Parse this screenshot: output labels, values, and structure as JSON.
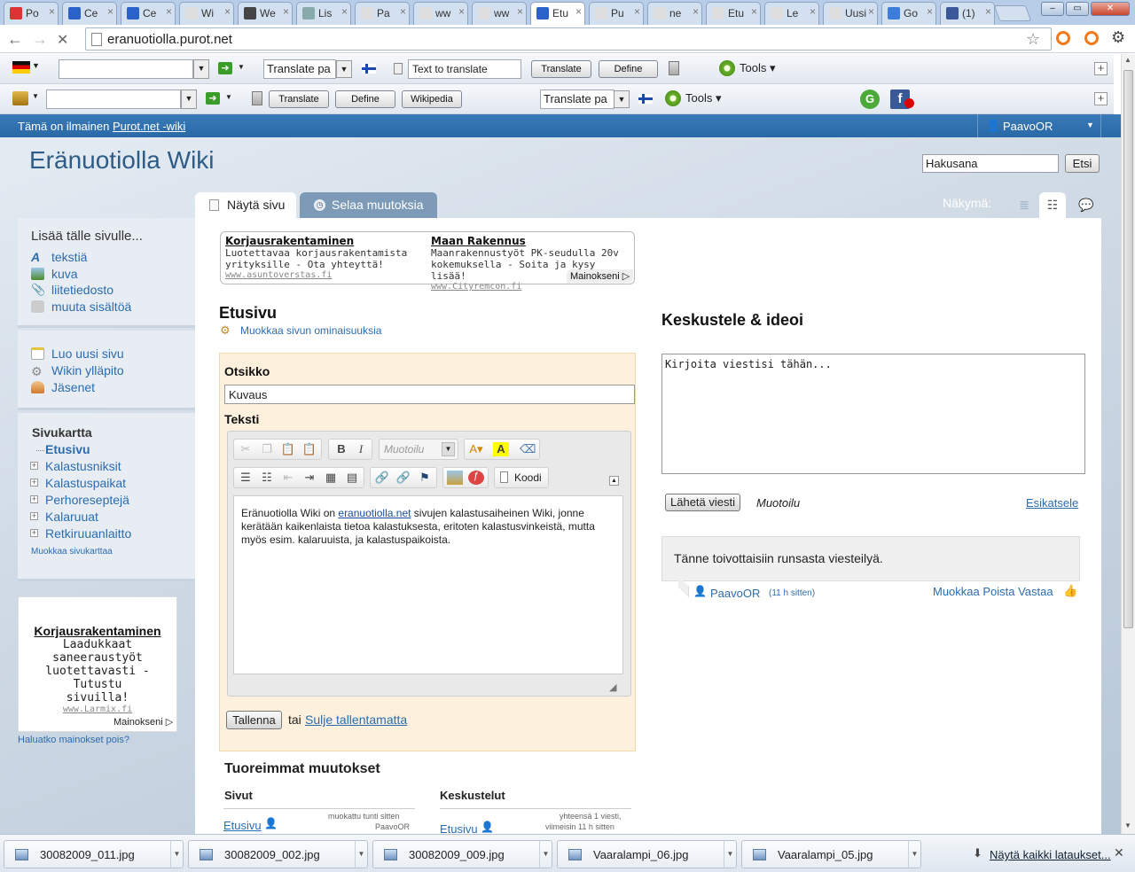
{
  "browser": {
    "tabs": [
      {
        "label": "Po",
        "color": "#d33"
      },
      {
        "label": "Ce",
        "color": "#2a62c9"
      },
      {
        "label": "Ce",
        "color": "#2a62c9"
      },
      {
        "label": "Wi",
        "color": "#ddd"
      },
      {
        "label": "We",
        "color": "#444"
      },
      {
        "label": "Lis",
        "color": "#8aa"
      },
      {
        "label": "Pa",
        "color": "#ddd"
      },
      {
        "label": "ww",
        "color": "#ddd"
      },
      {
        "label": "ww",
        "color": "#ddd"
      },
      {
        "label": "Etu",
        "color": "#2a62c9"
      },
      {
        "label": "Pu",
        "color": "#ddd"
      },
      {
        "label": "ne",
        "color": "#ddd"
      },
      {
        "label": "Etu",
        "color": "#ddd"
      },
      {
        "label": "Le",
        "color": "#ddd"
      },
      {
        "label": "Uusi v",
        "color": "#ddd"
      },
      {
        "label": "Go",
        "color": "#3b7dd8"
      },
      {
        "label": "(1)",
        "color": "#3b5998"
      }
    ],
    "close_glyph": "×",
    "url": "eranuotiolla.purot.net"
  },
  "toolbar1": {
    "translate_select": "Translate pa",
    "text_input_placeholder": "Text to translate",
    "translate_btn": "Translate",
    "define_btn": "Define",
    "tools": "Tools"
  },
  "toolbar2": {
    "translate_btn": "Translate",
    "define_btn": "Define",
    "wikipedia_btn": "Wikipedia",
    "translate_select": "Translate pa",
    "tools": "Tools"
  },
  "topband": {
    "prefix": "Tämä on ilmainen ",
    "link": "Purot.net -wiki",
    "user": "PaavoOR"
  },
  "site": {
    "title": "Eränuotiolla Wiki",
    "search_value": "Hakusana",
    "search_btn": "Etsi",
    "tab_view": "Näytä sivu",
    "tab_browse": "Selaa muutoksia",
    "view_label": "Näkymä:"
  },
  "sidebar": {
    "add_title": "Lisää tälle sivulle...",
    "add_items": [
      "tekstiä",
      "kuva",
      "liitetiedosto",
      "muuta sisältöä"
    ],
    "admin_items": [
      "Luo uusi sivu",
      "Wikin ylläpito",
      "Jäsenet"
    ],
    "sitemap_title": "Sivukartta",
    "sitemap_current": "Etusivu",
    "sitemap_items": [
      "Kalastusniksit",
      "Kalastuspaikat",
      "Perhoreseptejä",
      "Kalaruuat",
      "Retkiruuanlaitto"
    ],
    "edit_sitemap": "Muokkaa sivukarttaa",
    "ad": {
      "title": "Korjausrakentaminen",
      "l1": "Laadukkaat",
      "l2": "saneeraustyöt",
      "l3": "luotettavasti - Tutustu",
      "l4": "sivuilla!",
      "url": "www.Larmix.fi",
      "mainokseni": "Mainokseni"
    },
    "remove_ads": "Haluatko mainokset pois?"
  },
  "topad": {
    "a1_title": "Korjausrakentaminen",
    "a1_l1": "Luotettavaa korjausrakentamista",
    "a1_l2": "yrityksille - Ota yhteyttä!",
    "a1_url": "www.asuntoverstas.fi",
    "a2_title": "Maan Rakennus",
    "a2_l1": "Maanrakennustyöt PK-seudulla 20v",
    "a2_l2": "kokemuksella - Soita ja kysy lisää!",
    "a2_url": "www.Cityremcon.fi",
    "mainokseni": "Mainokseni"
  },
  "page": {
    "title": "Etusivu",
    "edit_props": "Muokkaa sivun ominaisuuksia",
    "label_otsikko": "Otsikko",
    "otsikko_value": "Kuvaus",
    "label_teksti": "Teksti",
    "format_select": "Muotoilu",
    "code_btn": "Koodi",
    "editor_text_1": "Eränuotiolla Wiki on ",
    "editor_link": "eranuotiolla.net",
    "editor_text_2": " sivujen kalastusaiheinen Wiki, jonne kerätään kaikenlaista tietoa kalastuksesta, eritoten kalastusvinkeistä, mutta myös esim. kalaruuista, ja kalastuspaikoista.",
    "save_btn": "Tallenna",
    "or": "tai",
    "close_link": "Sulje tallentamatta",
    "recent_title": "Tuoreimmat muutokset",
    "col_pages": "Sivut",
    "col_disc": "Keskustelut",
    "recent_page": "Etusivu",
    "recent_page_meta1": "muokattu tunti sitten",
    "recent_page_meta2": "PaavoOR",
    "recent_disc": "Etusivu",
    "recent_disc_meta1": "yhteensä 1 viesti,",
    "recent_disc_meta2": "viimeisin 11 h sitten"
  },
  "discussion": {
    "title": "Keskustele & ideoi",
    "placeholder": "Kirjoita viestisi tähän...",
    "send_btn": "Lähetä viesti",
    "format": "Muotoilu",
    "preview": "Esikatsele",
    "post_text": "Tänne toivottaisiin runsasta viesteilyä.",
    "post_author": "PaavoOR",
    "post_ago": "(11 h sitten)",
    "post_actions": "Muokkaa Poista Vastaa"
  },
  "downloads": {
    "items": [
      "30082009_011.jpg",
      "30082009_002.jpg",
      "30082009_009.jpg",
      "Vaaralampi_06.jpg",
      "Vaaralampi_05.jpg"
    ],
    "show_all": "Näytä kaikki lataukset..."
  }
}
